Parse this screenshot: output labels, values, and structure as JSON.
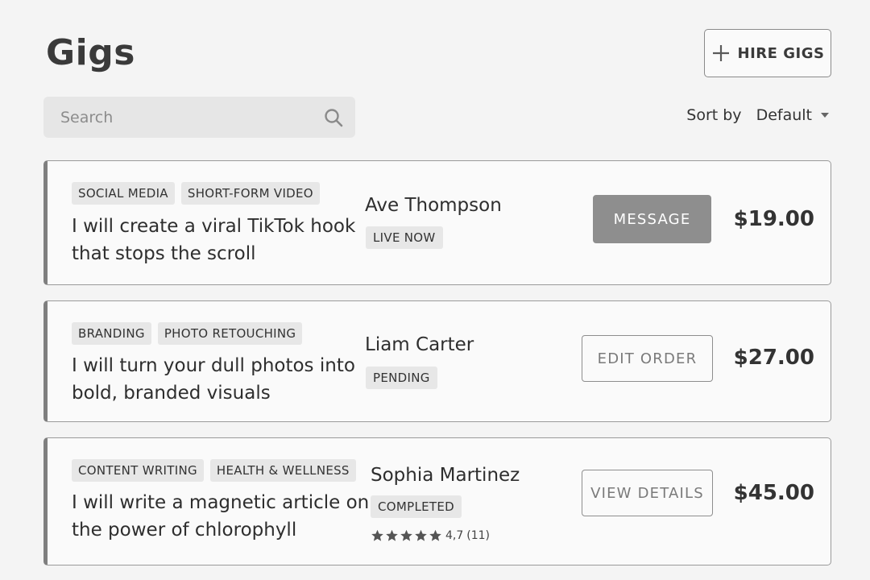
{
  "header": {
    "title": "Gigs",
    "hire_label": "HIRE GIGS"
  },
  "search": {
    "placeholder": "Search",
    "value": ""
  },
  "sort": {
    "label": "Sort by",
    "value": "Default"
  },
  "gigs": [
    {
      "tags": [
        "SOCIAL MEDIA",
        "SHORT-FORM VIDEO"
      ],
      "title": "I will create a viral TikTok hook that stops the scroll",
      "seller": "Ave Thompson",
      "status": "LIVE NOW",
      "action": "MESSAGE",
      "price": "$19.00"
    },
    {
      "tags": [
        "BRANDING",
        "PHOTO  RETOUCHING"
      ],
      "title": "I will turn your dull photos into bold, branded visuals",
      "seller": "Liam Carter",
      "status": "PENDING",
      "action": "EDIT ORDER",
      "price": "$27.00"
    },
    {
      "tags": [
        "CONTENT  WRITING",
        "HEALTH & WELLNESS"
      ],
      "title": "I will write a magnetic article on the power of chlorophyll",
      "seller": "Sophia Martinez",
      "status": "COMPLETED",
      "rating": {
        "stars": 5,
        "score": "4,7",
        "count": "(11)"
      },
      "action": "VIEW DETAILS",
      "price": "$45.00"
    }
  ],
  "icons": [
    "plus-icon",
    "search-icon",
    "caret-down-icon",
    "star-icon"
  ],
  "colors": {
    "background": "#f4f4f4",
    "card": "#fafafa",
    "filled_button": "#8e8e8e",
    "tag": "#e7e7e7"
  }
}
